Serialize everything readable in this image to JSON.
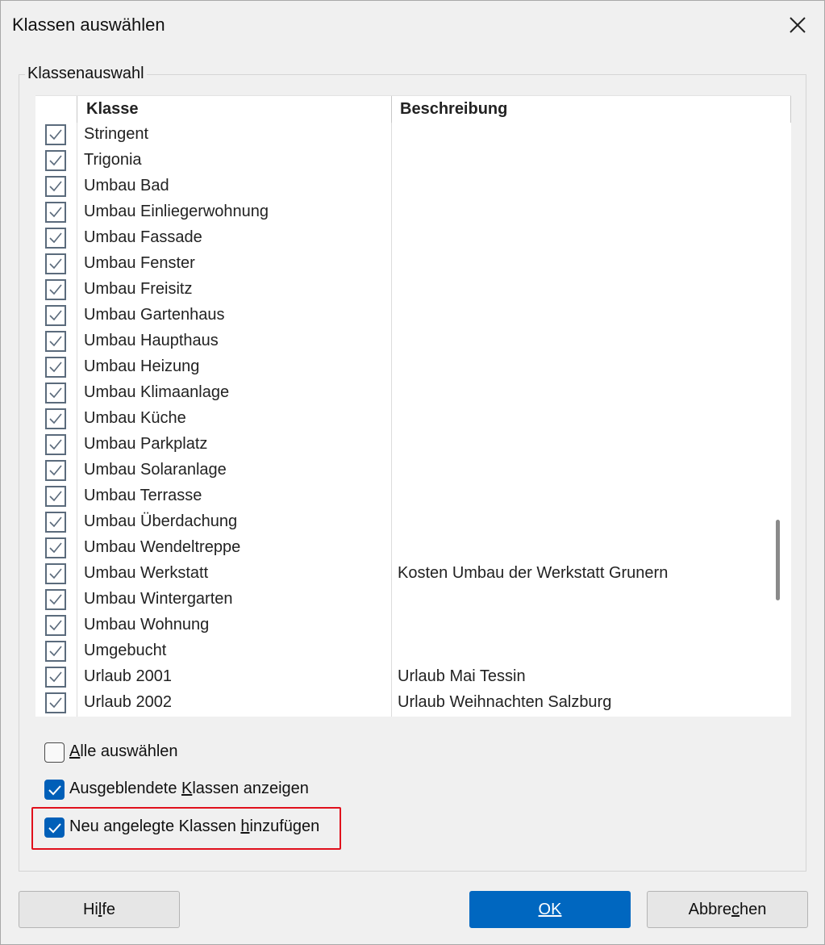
{
  "dialog": {
    "title": "Klassen auswählen",
    "close_icon": "close-icon"
  },
  "group": {
    "label": "Klassenauswahl"
  },
  "grid": {
    "columns": [
      "Klasse",
      "Beschreibung"
    ],
    "rows": [
      {
        "checked": true,
        "name": "Stringent",
        "description": ""
      },
      {
        "checked": true,
        "name": "Trigonia",
        "description": ""
      },
      {
        "checked": true,
        "name": "Umbau Bad",
        "description": ""
      },
      {
        "checked": true,
        "name": "Umbau Einliegerwohnung",
        "description": ""
      },
      {
        "checked": true,
        "name": "Umbau Fassade",
        "description": ""
      },
      {
        "checked": true,
        "name": "Umbau Fenster",
        "description": ""
      },
      {
        "checked": true,
        "name": "Umbau Freisitz",
        "description": ""
      },
      {
        "checked": true,
        "name": "Umbau Gartenhaus",
        "description": ""
      },
      {
        "checked": true,
        "name": "Umbau Haupthaus",
        "description": ""
      },
      {
        "checked": true,
        "name": "Umbau Heizung",
        "description": ""
      },
      {
        "checked": true,
        "name": "Umbau Klimaanlage",
        "description": ""
      },
      {
        "checked": true,
        "name": "Umbau Küche",
        "description": ""
      },
      {
        "checked": true,
        "name": "Umbau Parkplatz",
        "description": ""
      },
      {
        "checked": true,
        "name": "Umbau Solaranlage",
        "description": ""
      },
      {
        "checked": true,
        "name": "Umbau Terrasse",
        "description": ""
      },
      {
        "checked": true,
        "name": "Umbau Überdachung",
        "description": ""
      },
      {
        "checked": true,
        "name": "Umbau Wendeltreppe",
        "description": ""
      },
      {
        "checked": true,
        "name": "Umbau Werkstatt",
        "description": "Kosten Umbau der Werkstatt Grunern"
      },
      {
        "checked": true,
        "name": "Umbau Wintergarten",
        "description": ""
      },
      {
        "checked": true,
        "name": "Umbau Wohnung",
        "description": ""
      },
      {
        "checked": true,
        "name": "Umgebucht",
        "description": ""
      },
      {
        "checked": true,
        "name": "Urlaub 2001",
        "description": "Urlaub Mai Tessin"
      },
      {
        "checked": true,
        "name": "Urlaub 2002",
        "description": "Urlaub Weihnachten Salzburg"
      }
    ]
  },
  "options": {
    "select_all": {
      "pre": "",
      "accel": "A",
      "post": "lle auswählen",
      "checked": false
    },
    "show_hidden": {
      "pre": "Ausgeblendete ",
      "accel": "K",
      "post": "lassen anzeigen",
      "checked": true
    },
    "add_new": {
      "pre": "Neu angelegte Klassen ",
      "accel": "h",
      "post": "inzufügen",
      "checked": true
    }
  },
  "buttons": {
    "help": {
      "pre": "Hi",
      "accel": "l",
      "post": "fe"
    },
    "ok": {
      "pre": "",
      "accel": "OK",
      "post": ""
    },
    "cancel": {
      "pre": "Abbre",
      "accel": "c",
      "post": "hen"
    }
  },
  "colors": {
    "accent": "#0067c0",
    "checkbox_checked": "#005fb8",
    "highlight_border": "#e0101c"
  }
}
